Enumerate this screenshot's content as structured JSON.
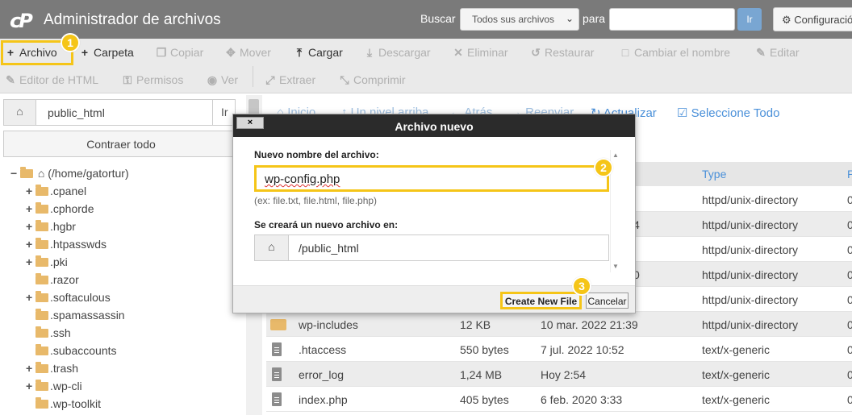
{
  "header": {
    "logo": "cP",
    "title": "Administrador de archivos",
    "search_label": "Buscar",
    "search_select_value": "Todos sus archivos",
    "for_label": "para",
    "search_input_value": "",
    "go_label": "Ir",
    "settings_label": "Configuración"
  },
  "toolbar": {
    "row1": [
      {
        "label": "Archivo",
        "icon": "plus-icon",
        "enabled": true
      },
      {
        "label": "Carpeta",
        "icon": "plus-icon",
        "enabled": true
      },
      {
        "label": "Copiar",
        "icon": "copy-icon",
        "enabled": false
      },
      {
        "label": "Mover",
        "icon": "move-icon",
        "enabled": false
      },
      {
        "label": "Cargar",
        "icon": "upload-icon",
        "enabled": true
      },
      {
        "label": "Descargar",
        "icon": "download-icon",
        "enabled": false
      },
      {
        "label": "Eliminar",
        "icon": "close-icon",
        "enabled": false
      },
      {
        "label": "Restaurar",
        "icon": "undo-icon",
        "enabled": false
      },
      {
        "label": "Cambiar el nombre",
        "icon": "file-icon",
        "enabled": false
      },
      {
        "label": "Editar",
        "icon": "pencil-icon",
        "enabled": false
      }
    ],
    "row2": [
      {
        "label": "Editor de HTML",
        "icon": "edit-icon",
        "enabled": false
      },
      {
        "label": "Permisos",
        "icon": "key-icon",
        "enabled": false
      },
      {
        "label": "Ver",
        "icon": "eye-icon",
        "enabled": false
      },
      {
        "label": "Extraer",
        "icon": "expand-icon",
        "enabled": false
      },
      {
        "label": "Comprimir",
        "icon": "compress-icon",
        "enabled": false
      }
    ]
  },
  "left": {
    "path_value": "public_html",
    "path_go": "Ir",
    "collapse_label": "Contraer todo",
    "tree_root": "(/home/gatortur)",
    "tree": [
      {
        "name": ".cpanel",
        "expandable": true
      },
      {
        "name": ".cphorde",
        "expandable": true
      },
      {
        "name": ".hgbr",
        "expandable": true
      },
      {
        "name": ".htpasswds",
        "expandable": true
      },
      {
        "name": ".pki",
        "expandable": true
      },
      {
        "name": ".razor",
        "expandable": false
      },
      {
        "name": ".softaculous",
        "expandable": true
      },
      {
        "name": ".spamassassin",
        "expandable": false
      },
      {
        "name": ".ssh",
        "expandable": false
      },
      {
        "name": ".subaccounts",
        "expandable": false
      },
      {
        "name": ".trash",
        "expandable": true
      },
      {
        "name": ".wp-cli",
        "expandable": true
      },
      {
        "name": ".wp-toolkit",
        "expandable": false
      }
    ]
  },
  "nav": {
    "home": "Inicio",
    "up": "Un nivel arriba",
    "back": "Atrás",
    "forward": "Reenviar",
    "refresh": "Actualizar",
    "select_all": "Seleccione Todo"
  },
  "table": {
    "col_type": "Type",
    "col_perm": "P",
    "rows": [
      {
        "name": "",
        "size": "",
        "date": "",
        "type": "httpd/unix-directory",
        "perm": "0",
        "icon": "none"
      },
      {
        "name": "",
        "size": "",
        "date": "4",
        "type": "httpd/unix-directory",
        "perm": "0",
        "icon": "none"
      },
      {
        "name": "",
        "size": "",
        "date": "",
        "type": "httpd/unix-directory",
        "perm": "0",
        "icon": "none"
      },
      {
        "name": "",
        "size": "",
        "date": "0",
        "type": "httpd/unix-directory",
        "perm": "0",
        "icon": "none"
      },
      {
        "name": "",
        "size": "",
        "date": "",
        "type": "httpd/unix-directory",
        "perm": "0",
        "icon": "none"
      },
      {
        "name": "wp-includes",
        "size": "12 KB",
        "date": "10 mar. 2022 21:39",
        "type": "httpd/unix-directory",
        "perm": "0",
        "icon": "folder"
      },
      {
        "name": ".htaccess",
        "size": "550 bytes",
        "date": "7 jul. 2022 10:52",
        "type": "text/x-generic",
        "perm": "0",
        "icon": "file"
      },
      {
        "name": "error_log",
        "size": "1,24 MB",
        "date": "Hoy 2:54",
        "type": "text/x-generic",
        "perm": "0",
        "icon": "file"
      },
      {
        "name": "index.php",
        "size": "405 bytes",
        "date": "6 feb. 2020 3:33",
        "type": "text/x-generic",
        "perm": "0",
        "icon": "file"
      }
    ]
  },
  "modal": {
    "title": "Archivo nuevo",
    "close_label": "×",
    "name_label": "Nuevo nombre del archivo:",
    "name_value": "wp-config.php",
    "hint": "(ex: file.txt, file.html, file.php)",
    "location_label": "Se creará un nuevo archivo en:",
    "location_value": "/public_html",
    "create_label": "Create New File",
    "cancel_label": "Cancelar"
  },
  "badges": [
    "1",
    "2",
    "3"
  ],
  "colors": {
    "accent": "#f5c518",
    "link": "#4a90d9",
    "header": "#7a7a7a"
  }
}
